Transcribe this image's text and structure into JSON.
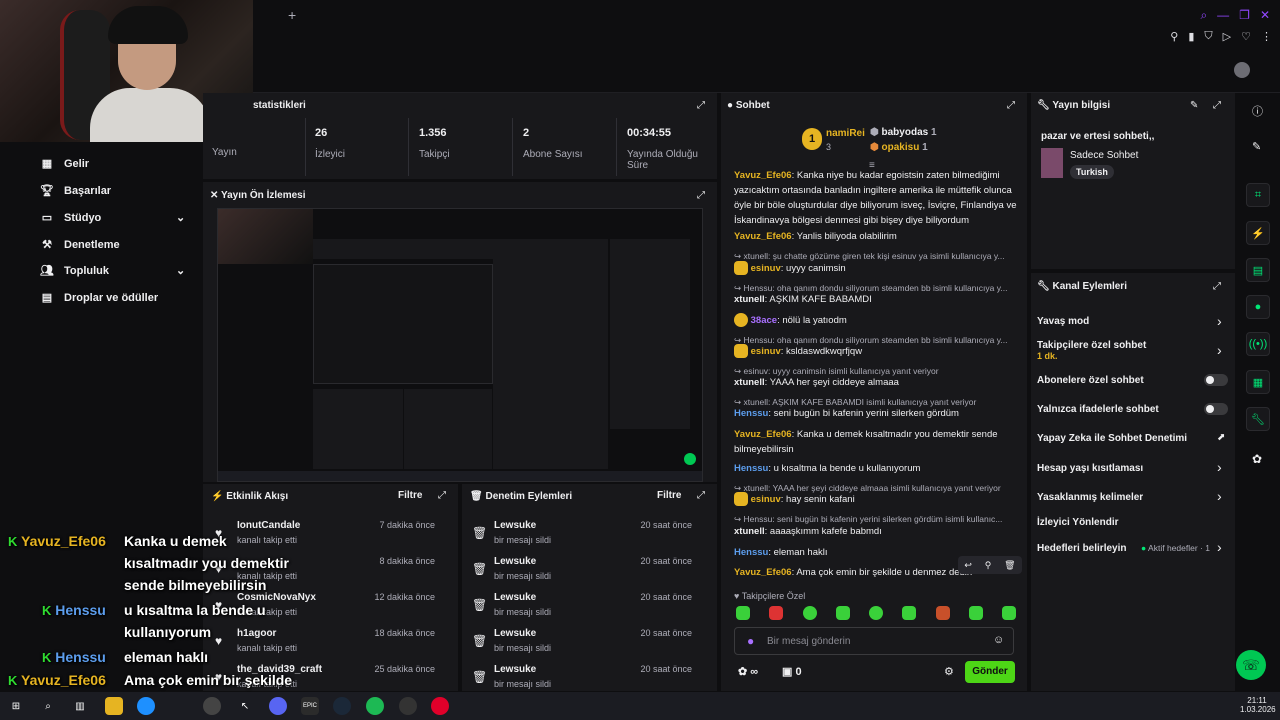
{
  "stats": {
    "title": "statistikleri",
    "items": [
      {
        "value": "",
        "label": "Yayın"
      },
      {
        "value": "26",
        "label": "İzleyici"
      },
      {
        "value": "1.356",
        "label": "Takipçi"
      },
      {
        "value": "2",
        "label": "Abone Sayısı"
      },
      {
        "value": "00:34:55",
        "label": "Yayında Olduğu Süre"
      }
    ]
  },
  "sidebar": {
    "items": [
      {
        "label": "Gelir"
      },
      {
        "label": "Başarılar"
      },
      {
        "label": "Stüdyo"
      },
      {
        "label": "Denetleme"
      },
      {
        "label": "Topluluk"
      },
      {
        "label": "Droplar ve ödüller"
      }
    ]
  },
  "preview": {
    "title": "Yayın Ön İzlemesi"
  },
  "activity": {
    "title": "Etkinlik Akışı",
    "filter": "Filtre",
    "rows": [
      {
        "name": "IonutCandale",
        "sub": "kanalı takip etti",
        "time": "7 dakika önce"
      },
      {
        "name": "",
        "sub": "kanalı takip etti",
        "time": "8 dakika önce"
      },
      {
        "name": "CosmicNovaNyx",
        "sub": "kanalı takip etti",
        "time": "12 dakika önce"
      },
      {
        "name": "h1agoor",
        "sub": "kanalı takip etti",
        "time": "18 dakika önce"
      },
      {
        "name": "the_david39_craft",
        "sub": "kanalı takip etti",
        "time": "25 dakika önce"
      }
    ]
  },
  "mod_actions": {
    "title": "Denetim Eylemleri",
    "filter": "Filtre",
    "rows": [
      {
        "name": "Lewsuke",
        "sub": "bir mesajı sildi",
        "time": "20 saat önce"
      },
      {
        "name": "Lewsuke",
        "sub": "bir mesajı sildi",
        "time": "20 saat önce"
      },
      {
        "name": "Lewsuke",
        "sub": "bir mesajı sildi",
        "time": "20 saat önce"
      },
      {
        "name": "Lewsuke",
        "sub": "bir mesajı sildi",
        "time": "20 saat önce"
      },
      {
        "name": "Lewsuke",
        "sub": "bir mesajı sildi",
        "time": "20 saat önce"
      }
    ]
  },
  "chat": {
    "title": "Sohbet",
    "leaderboard": [
      {
        "rank": "1",
        "name": "namiRei",
        "count": "3"
      },
      {
        "rank": "",
        "name": "babyodas",
        "count": "1"
      },
      {
        "rank": "",
        "name": "opakisu",
        "count": "1"
      }
    ],
    "messages": [
      {
        "user": "Yavuz_Efe06",
        "color": "y",
        "text": "Kanka niye bu kadar egoistsin zaten bilmediğimi yazıcaktım ortasında banladın ingiltere amerika ile müttefik olunca öyle bir böle oluşturdular diye biliyorum isveç, İsviçre, Finlandiya ve İskandinavya bölgesi denmesi gibi bişey diye biliyordum"
      },
      {
        "user": "Yavuz_Efe06",
        "color": "y",
        "text": "Yanlis biliyoda olabilirim"
      },
      {
        "reply": "xtunell: şu chatte gözüme giren tek kişi esinuv ya isimli kullanıcıya y..."
      },
      {
        "user": "esinuv",
        "color": "y",
        "text": "uyyy canimsin"
      },
      {
        "reply": "Henssu: oha qanım dondu siliyorum steamden bb isimli kullanıcıya y..."
      },
      {
        "user": "xtunell",
        "color": "w",
        "text": "AŞKIM KAFE BABAMDI"
      },
      {
        "user": "38ace",
        "color": "p",
        "text": "nölü la yatıodm"
      },
      {
        "reply": "Henssu: oha qanım dondu siliyorum steamden bb isimli kullanıcıya y..."
      },
      {
        "user": "esinuv",
        "color": "y",
        "text": "ksldaswdkwqrfjqw"
      },
      {
        "reply": "esinuv: uyyy canimsin isimli kullanıcıya yanıt veriyor"
      },
      {
        "user": "xtunell",
        "color": "w",
        "text": "YAAA her şeyi ciddeye almaaa"
      },
      {
        "reply": "xtunell: AŞKIM KAFE BABAMDI isimli kullanıcıya yanıt veriyor"
      },
      {
        "user": "Henssu",
        "color": "b",
        "text": "seni bugün bi kafenin yerini silerken gördüm"
      },
      {
        "user": "Yavuz_Efe06",
        "color": "y",
        "text": "Kanka u demek kısaltmadır you demektir sende bilmeyebilirsin"
      },
      {
        "user": "Henssu",
        "color": "b",
        "text": "u kısaltma la bende u kullanıyorum"
      },
      {
        "reply": "xtunell: YAAA her şeyi ciddeye almaaa isimli kullanıcıya yanıt veriyor"
      },
      {
        "user": "esinuv",
        "color": "y",
        "text": "hay senin kafani"
      },
      {
        "reply": "Henssu: seni bugün bi kafenin yerini silerken gördüm isimli kullanıc..."
      },
      {
        "user": "xtunell",
        "color": "w",
        "text": "aaaaşkımm kafefe babmdı"
      },
      {
        "user": "Henssu",
        "color": "b",
        "text": "eleman haklı"
      },
      {
        "user": "Yavuz_Efe06",
        "color": "y",
        "text": "Ama çok emin bir şekilde u denmez dedin"
      }
    ],
    "followers_only": "Takipçilere Özel",
    "input_placeholder": "Bir mesaj gönderin",
    "points": "∞",
    "gift_count": "0",
    "send_label": "Gönder"
  },
  "stream_info": {
    "title": "Yayın bilgisi",
    "stream_title": "pazar ve ertesi sohbeti,,",
    "category": "Sadece Sohbet",
    "tag": "Turkish"
  },
  "channel_actions": {
    "title": "Kanal Eylemleri",
    "items": [
      {
        "label": "Yavaş mod"
      },
      {
        "label": "Takipçilere özel sohbet",
        "sub": "1 dk."
      },
      {
        "label": "Abonelere özel sohbet"
      },
      {
        "label": "Yalnızca ifadelerle sohbet"
      },
      {
        "label": "Yapay Zeka ile Sohbet Denetimi"
      },
      {
        "label": "Hesap yaşı kısıtlaması"
      },
      {
        "label": "Yasaklanmış kelimeler"
      },
      {
        "label": "İzleyici Yönlendir"
      },
      {
        "label": "Hedefleri belirleyin",
        "extra": "Aktif hedefler · 1"
      }
    ]
  },
  "overlay": [
    {
      "user": "Yavuz_Efe06",
      "text": "Kanka u demek kısaltmadır you demektir sende bilmeyebilirsin"
    },
    {
      "user": "Henssu",
      "text": "u kısaltma la bende u kullanıyorum"
    },
    {
      "user": "Henssu",
      "text": "eleman haklı"
    },
    {
      "user": "Yavuz_Efe06",
      "text": "Ama çok emin bir şekilde u denmez dedin"
    }
  ],
  "taskbar": {
    "time": "21:11",
    "date": "1.03.2026"
  },
  "colors": {
    "accent": "#9147ff",
    "green": "#00e676",
    "send": "#4dd616",
    "username_yellow": "#e6b422",
    "username_blue": "#5c9ded"
  }
}
